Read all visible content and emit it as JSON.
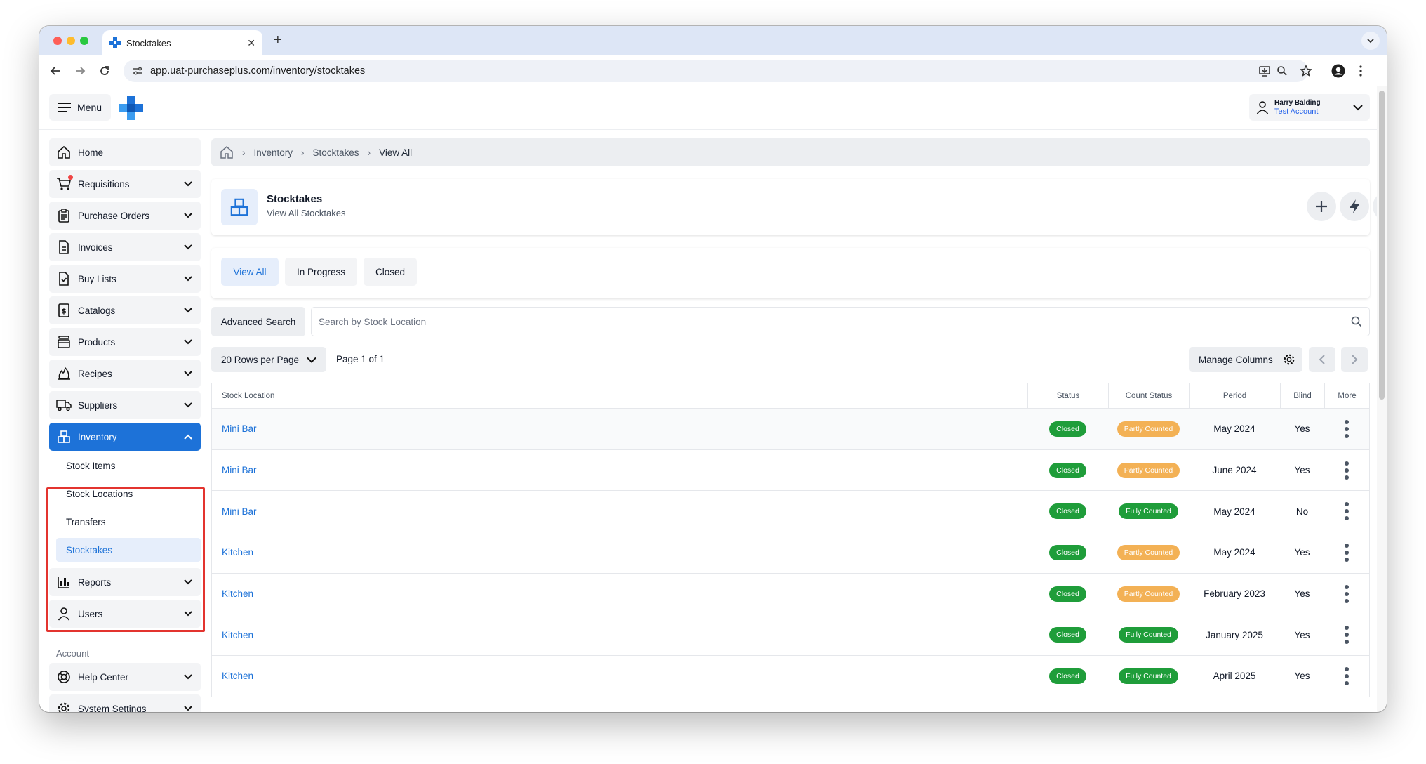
{
  "browser": {
    "tab_title": "Stocktakes",
    "new_tab": "+",
    "tab_close": "✕",
    "url": "app.uat-purchaseplus.com/inventory/stocktakes"
  },
  "header": {
    "menu_label": "Menu",
    "user_name": "Harry Balding",
    "account_name": "Test Account"
  },
  "sidebar": {
    "items": [
      {
        "label": "Home",
        "icon": "home-icon"
      },
      {
        "label": "Requisitions",
        "icon": "cart-icon"
      },
      {
        "label": "Purchase Orders",
        "icon": "clipboard-icon"
      },
      {
        "label": "Invoices",
        "icon": "document-icon"
      },
      {
        "label": "Buy Lists",
        "icon": "checklist-icon"
      },
      {
        "label": "Catalogs",
        "icon": "dollar-doc-icon"
      },
      {
        "label": "Products",
        "icon": "products-icon"
      },
      {
        "label": "Recipes",
        "icon": "flame-icon"
      },
      {
        "label": "Suppliers",
        "icon": "truck-icon"
      },
      {
        "label": "Inventory",
        "icon": "boxes-icon"
      }
    ],
    "inventory_sub": [
      "Stock Items",
      "Stock Locations",
      "Transfers",
      "Stocktakes"
    ],
    "lower_items": [
      {
        "label": "Reports",
        "icon": "bar-chart-icon"
      },
      {
        "label": "Users",
        "icon": "user-icon"
      }
    ],
    "account_heading": "Account",
    "account_items": [
      {
        "label": "Help Center",
        "icon": "lifebuoy-icon"
      },
      {
        "label": "System Settings",
        "icon": "gear-icon"
      }
    ],
    "accent_color": "#1d72d8",
    "highlight_color": "#e3342f"
  },
  "breadcrumb": [
    "Inventory",
    "Stocktakes",
    "View All"
  ],
  "page": {
    "title": "Stocktakes",
    "subtitle": "View All Stocktakes"
  },
  "filters": [
    "View All",
    "In Progress",
    "Closed"
  ],
  "search": {
    "advanced_label": "Advanced Search",
    "placeholder": "Search by Stock Location"
  },
  "pagination": {
    "rows_per_page": "20 Rows per Page",
    "page_info": "Page 1 of 1",
    "manage_columns": "Manage Columns"
  },
  "table": {
    "columns": [
      "Stock Location",
      "Status",
      "Count Status",
      "Period",
      "Blind",
      "More"
    ],
    "rows": [
      {
        "location": "Mini Bar",
        "status": "Closed",
        "count_status": "Partly Counted",
        "period": "May 2024",
        "blind": "Yes"
      },
      {
        "location": "Mini Bar",
        "status": "Closed",
        "count_status": "Partly Counted",
        "period": "June 2024",
        "blind": "Yes"
      },
      {
        "location": "Mini Bar",
        "status": "Closed",
        "count_status": "Fully Counted",
        "period": "May 2024",
        "blind": "No"
      },
      {
        "location": "Kitchen",
        "status": "Closed",
        "count_status": "Partly Counted",
        "period": "May 2024",
        "blind": "Yes"
      },
      {
        "location": "Kitchen",
        "status": "Closed",
        "count_status": "Partly Counted",
        "period": "February 2023",
        "blind": "Yes"
      },
      {
        "location": "Kitchen",
        "status": "Closed",
        "count_status": "Fully Counted",
        "period": "January 2025",
        "blind": "Yes"
      },
      {
        "location": "Kitchen",
        "status": "Closed",
        "count_status": "Fully Counted",
        "period": "April 2025",
        "blind": "Yes"
      }
    ],
    "status_colors": {
      "Closed": "#1f9d3a",
      "Fully Counted": "#1f9d3a",
      "Partly Counted": "#f3b155"
    }
  }
}
